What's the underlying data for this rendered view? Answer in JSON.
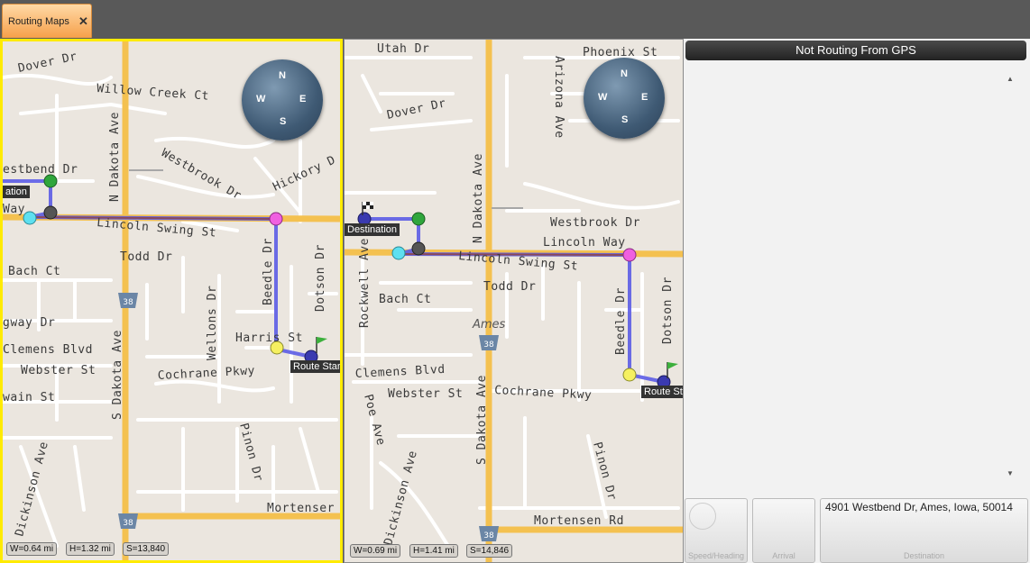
{
  "tab": {
    "label": "Routing Maps",
    "close": "✕"
  },
  "map1": {
    "streets": [
      "Dover Dr",
      "Willow Creek Ct",
      "N Dakota Ave",
      "Westbrook Dr",
      "Hickory D",
      "estbend Dr",
      "Lincoln Swing St",
      "Way",
      "Todd Dr",
      "Bach Ct",
      "Beedle Dr",
      "Dotson Dr",
      "gway Dr",
      "Wellons Dr",
      "Harris St",
      "Clemens Blvd",
      "Webster St",
      "Cochrane Pkwy",
      "S Dakota Ave",
      "wain St",
      "Pinon Dr",
      "Dickinson Ave",
      "Mortenser"
    ],
    "shield": "38",
    "labels": {
      "destination": "ation",
      "route_start": "Route Star"
    },
    "scale": {
      "w": "W=0.64 mi",
      "h": "H=1.32 mi",
      "s": "S=13,840"
    },
    "compass": {
      "n": "N",
      "e": "E",
      "s": "S",
      "w": "W"
    }
  },
  "map2": {
    "streets": [
      "Utah Dr",
      "Phoenix St",
      "Arizona Ave",
      "Dover Dr",
      "N Dakota Ave",
      "Westbrook Dr",
      "Lincoln Way",
      "Lincoln Swing St",
      "Rockwell Ave",
      "Bach Ct",
      "Todd Dr",
      "Beedle Dr",
      "Dotson Dr",
      "Clemens Blvd",
      "Webster St",
      "Cochrane Pkwy",
      "Poe Ave",
      "S Dakota Ave",
      "Pinon Dr",
      "Dickinson Ave",
      "Mortensen Rd"
    ],
    "city": "Ames",
    "shield": "38",
    "labels": {
      "destination": "Destination",
      "route_start": "Route St"
    },
    "scale": {
      "w": "W=0.69 mi",
      "h": "H=1.41 mi",
      "s": "S=14,846"
    },
    "compass": {
      "n": "N",
      "e": "E",
      "s": "S",
      "w": "W"
    }
  },
  "panel": {
    "status": "Not Routing From GPS",
    "scroll_up": "▲",
    "scroll_down": "▼",
    "speed_caption": "Speed/Heading",
    "arrival_caption": "Arrival",
    "destination_caption": "Destination",
    "destination_value": "4901 Westbend Dr, Ames, Iowa, 50014"
  }
}
